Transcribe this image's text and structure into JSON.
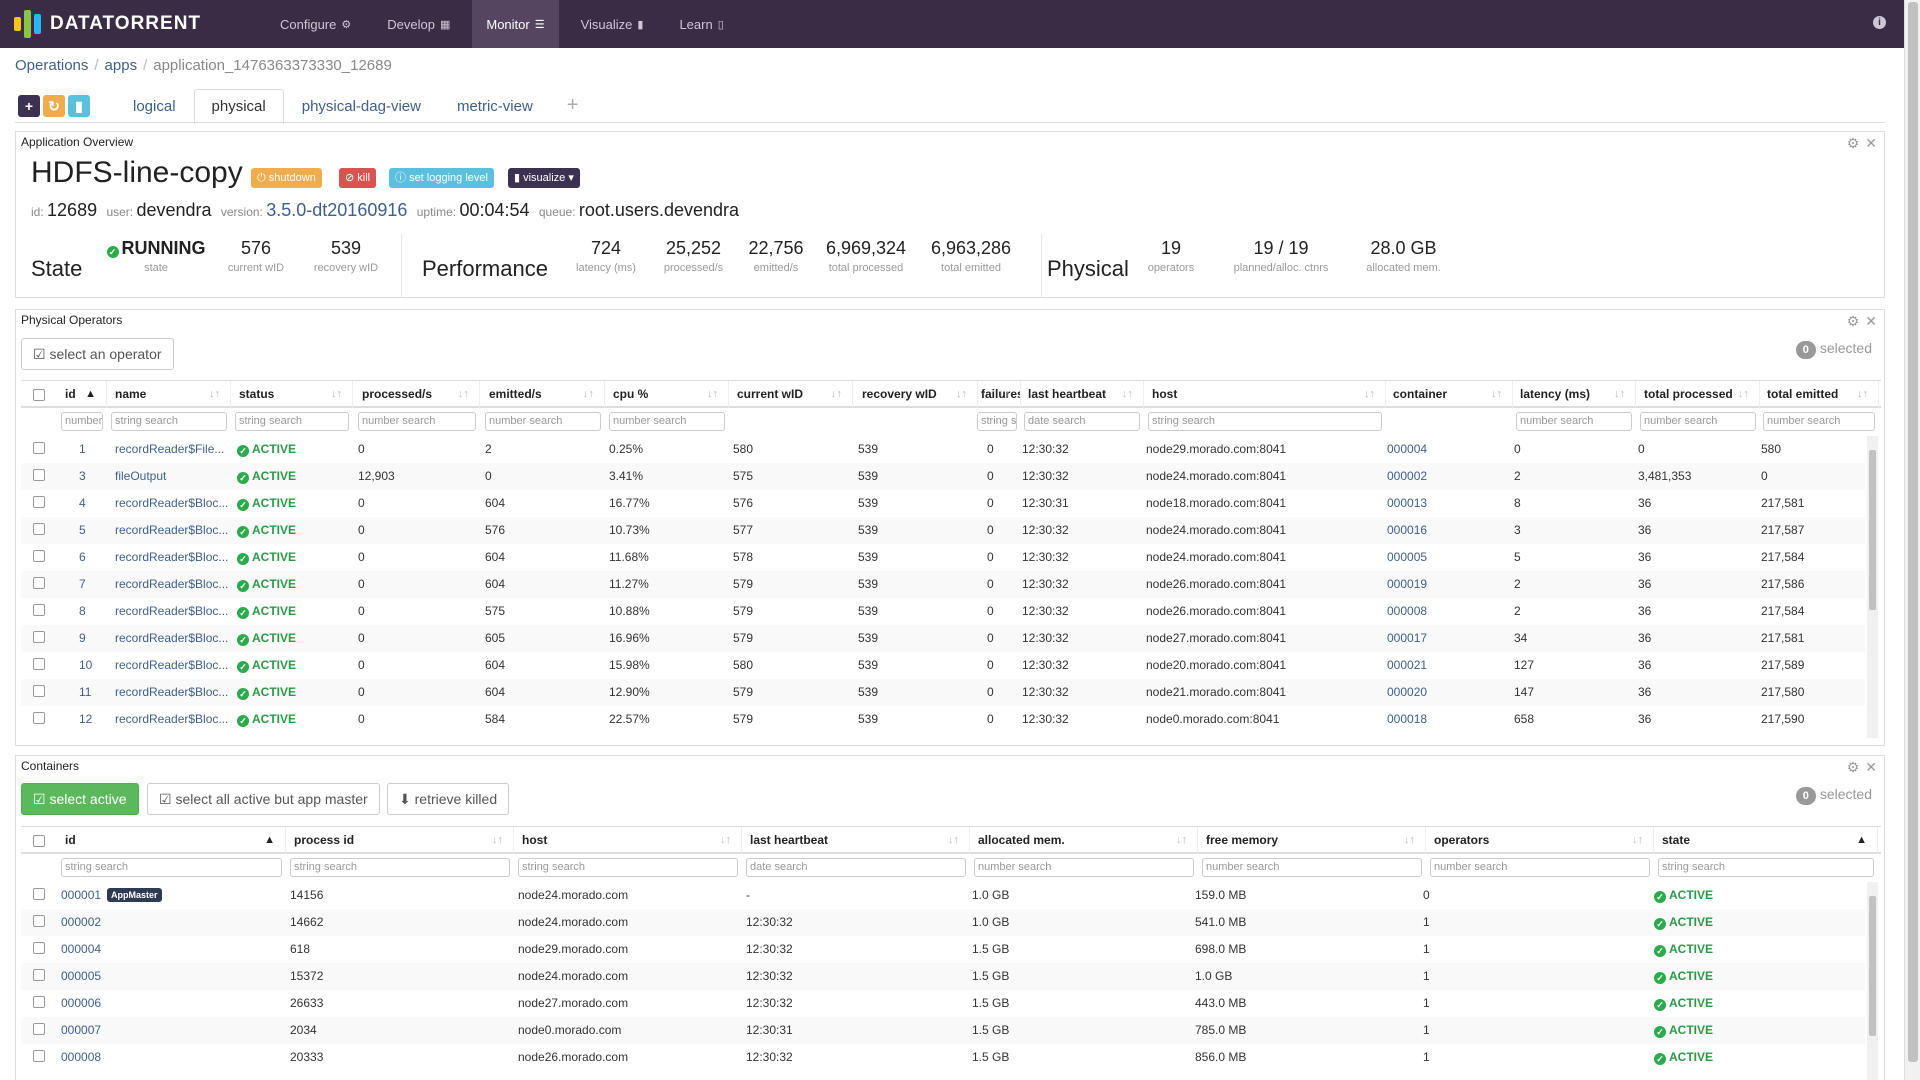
{
  "brand": "DATATORRENT",
  "nav": [
    {
      "label": "Configure",
      "icon": "gear-icon"
    },
    {
      "label": "Develop",
      "icon": "grid-icon"
    },
    {
      "label": "Monitor",
      "icon": "list-icon"
    },
    {
      "label": "Visualize",
      "icon": "bar-chart-icon"
    },
    {
      "label": "Learn",
      "icon": "book-icon"
    }
  ],
  "breadcrumb": [
    "Operations",
    "apps",
    "application_1476363373330_12689"
  ],
  "tabs": [
    "logical",
    "physical",
    "physical-dag-view",
    "metric-view"
  ],
  "overview": {
    "panel_title": "Application Overview",
    "app_name": "HDFS-line-copy",
    "buttons": {
      "shutdown": "shutdown",
      "kill": "kill",
      "logging": "set logging level",
      "visualize": "visualize"
    },
    "meta": {
      "id_label": "id:",
      "id": "12689",
      "user_label": "user:",
      "user": "devendra",
      "version_label": "version:",
      "version": "3.5.0-dt20160916",
      "uptime_label": "uptime:",
      "uptime": "00:04:54",
      "queue_label": "queue:",
      "queue": "root.users.devendra"
    },
    "state": {
      "heading": "State",
      "status": "RUNNING",
      "status_label": "state",
      "current_wid": "576",
      "current_wid_label": "current wID",
      "recovery_wid": "539",
      "recovery_wid_label": "recovery wID"
    },
    "performance": {
      "heading": "Performance",
      "latency": "724",
      "latency_label": "latency (ms)",
      "processed": "25,252",
      "processed_label": "processed/s",
      "emitted": "22,756",
      "emitted_label": "emitted/s",
      "total_processed": "6,969,324",
      "total_processed_label": "total processed",
      "total_emitted": "6,963,286",
      "total_emitted_label": "total emitted"
    },
    "physical": {
      "heading": "Physical",
      "operators": "19",
      "operators_label": "operators",
      "ctnrs": "19 / 19",
      "ctnrs_label": "planned/alloc. ctnrs",
      "mem": "28.0 GB",
      "mem_label": "allocated mem."
    }
  },
  "operators": {
    "panel_title": "Physical Operators",
    "select_btn": "select an operator",
    "selected_count": "0",
    "selected_label": "selected",
    "columns": [
      "id",
      "name",
      "status",
      "processed/s",
      "emitted/s",
      "cpu %",
      "current wID",
      "recovery wID",
      "failures",
      "last heartbeat",
      "host",
      "container",
      "latency (ms)",
      "total processed",
      "total emitted"
    ],
    "filters": [
      "number",
      "string search",
      "string search",
      "number search",
      "number search",
      "number search",
      "",
      "",
      "string se",
      "date search",
      "string search",
      "",
      "number search",
      "number search",
      "number search"
    ],
    "rows": [
      [
        "1",
        "recordReader$File...",
        "ACTIVE",
        "0",
        "2",
        "0.25%",
        "580",
        "539",
        "0",
        "12:30:32",
        "node29.morado.com:8041",
        "000004",
        "0",
        "0",
        "580"
      ],
      [
        "3",
        "fileOutput",
        "ACTIVE",
        "12,903",
        "0",
        "3.41%",
        "575",
        "539",
        "0",
        "12:30:32",
        "node24.morado.com:8041",
        "000002",
        "2",
        "3,481,353",
        "0"
      ],
      [
        "4",
        "recordReader$Bloc...",
        "ACTIVE",
        "0",
        "604",
        "16.77%",
        "576",
        "539",
        "0",
        "12:30:31",
        "node18.morado.com:8041",
        "000013",
        "8",
        "36",
        "217,581"
      ],
      [
        "5",
        "recordReader$Bloc...",
        "ACTIVE",
        "0",
        "576",
        "10.73%",
        "577",
        "539",
        "0",
        "12:30:32",
        "node24.morado.com:8041",
        "000016",
        "3",
        "36",
        "217,587"
      ],
      [
        "6",
        "recordReader$Bloc...",
        "ACTIVE",
        "0",
        "604",
        "11.68%",
        "578",
        "539",
        "0",
        "12:30:32",
        "node24.morado.com:8041",
        "000005",
        "5",
        "36",
        "217,584"
      ],
      [
        "7",
        "recordReader$Bloc...",
        "ACTIVE",
        "0",
        "604",
        "11.27%",
        "579",
        "539",
        "0",
        "12:30:32",
        "node26.morado.com:8041",
        "000019",
        "2",
        "36",
        "217,586"
      ],
      [
        "8",
        "recordReader$Bloc...",
        "ACTIVE",
        "0",
        "575",
        "10.88%",
        "579",
        "539",
        "0",
        "12:30:32",
        "node26.morado.com:8041",
        "000008",
        "2",
        "36",
        "217,584"
      ],
      [
        "9",
        "recordReader$Bloc...",
        "ACTIVE",
        "0",
        "605",
        "16.96%",
        "579",
        "539",
        "0",
        "12:30:32",
        "node27.morado.com:8041",
        "000017",
        "34",
        "36",
        "217,581"
      ],
      [
        "10",
        "recordReader$Bloc...",
        "ACTIVE",
        "0",
        "604",
        "15.98%",
        "580",
        "539",
        "0",
        "12:30:32",
        "node20.morado.com:8041",
        "000021",
        "127",
        "36",
        "217,589"
      ],
      [
        "11",
        "recordReader$Bloc...",
        "ACTIVE",
        "0",
        "604",
        "12.90%",
        "579",
        "539",
        "0",
        "12:30:32",
        "node21.morado.com:8041",
        "000020",
        "147",
        "36",
        "217,580"
      ],
      [
        "12",
        "recordReader$Bloc...",
        "ACTIVE",
        "0",
        "584",
        "22.57%",
        "579",
        "539",
        "0",
        "12:30:32",
        "node0.morado.com:8041",
        "000018",
        "658",
        "36",
        "217,590"
      ]
    ]
  },
  "containers": {
    "panel_title": "Containers",
    "buttons": [
      "select active",
      "select all active but app master",
      "retrieve killed"
    ],
    "selected_count": "0",
    "selected_label": "selected",
    "columns": [
      "id",
      "process id",
      "host",
      "last heartbeat",
      "allocated mem.",
      "free memory",
      "operators",
      "state"
    ],
    "filters": [
      "string search",
      "string search",
      "string search",
      "date search",
      "number search",
      "number search",
      "number search",
      "string search"
    ],
    "appmaster_badge": "AppMaster",
    "rows": [
      [
        "000001",
        "14156",
        "node24.morado.com",
        "-",
        "1.0 GB",
        "159.0 MB",
        "0",
        "ACTIVE"
      ],
      [
        "000002",
        "14662",
        "node24.morado.com",
        "12:30:32",
        "1.0 GB",
        "541.0 MB",
        "1",
        "ACTIVE"
      ],
      [
        "000004",
        "618",
        "node29.morado.com",
        "12:30:32",
        "1.5 GB",
        "698.0 MB",
        "1",
        "ACTIVE"
      ],
      [
        "000005",
        "15372",
        "node24.morado.com",
        "12:30:32",
        "1.5 GB",
        "1.0 GB",
        "1",
        "ACTIVE"
      ],
      [
        "000006",
        "26633",
        "node27.morado.com",
        "12:30:32",
        "1.5 GB",
        "443.0 MB",
        "1",
        "ACTIVE"
      ],
      [
        "000007",
        "2034",
        "node0.morado.com",
        "12:30:31",
        "1.5 GB",
        "785.0 MB",
        "1",
        "ACTIVE"
      ],
      [
        "000008",
        "20333",
        "node26.morado.com",
        "12:30:32",
        "1.5 GB",
        "856.0 MB",
        "1",
        "ACTIVE"
      ]
    ]
  },
  "colors": {
    "topbar": "#3a2c45",
    "link": "#3f5f8c",
    "active": "#2b9a48",
    "shutdown": "#f0ad4e",
    "kill": "#d9534f",
    "logging": "#5bc0de",
    "visualize": "#3d3152",
    "green_btn": "#5cb85c"
  }
}
